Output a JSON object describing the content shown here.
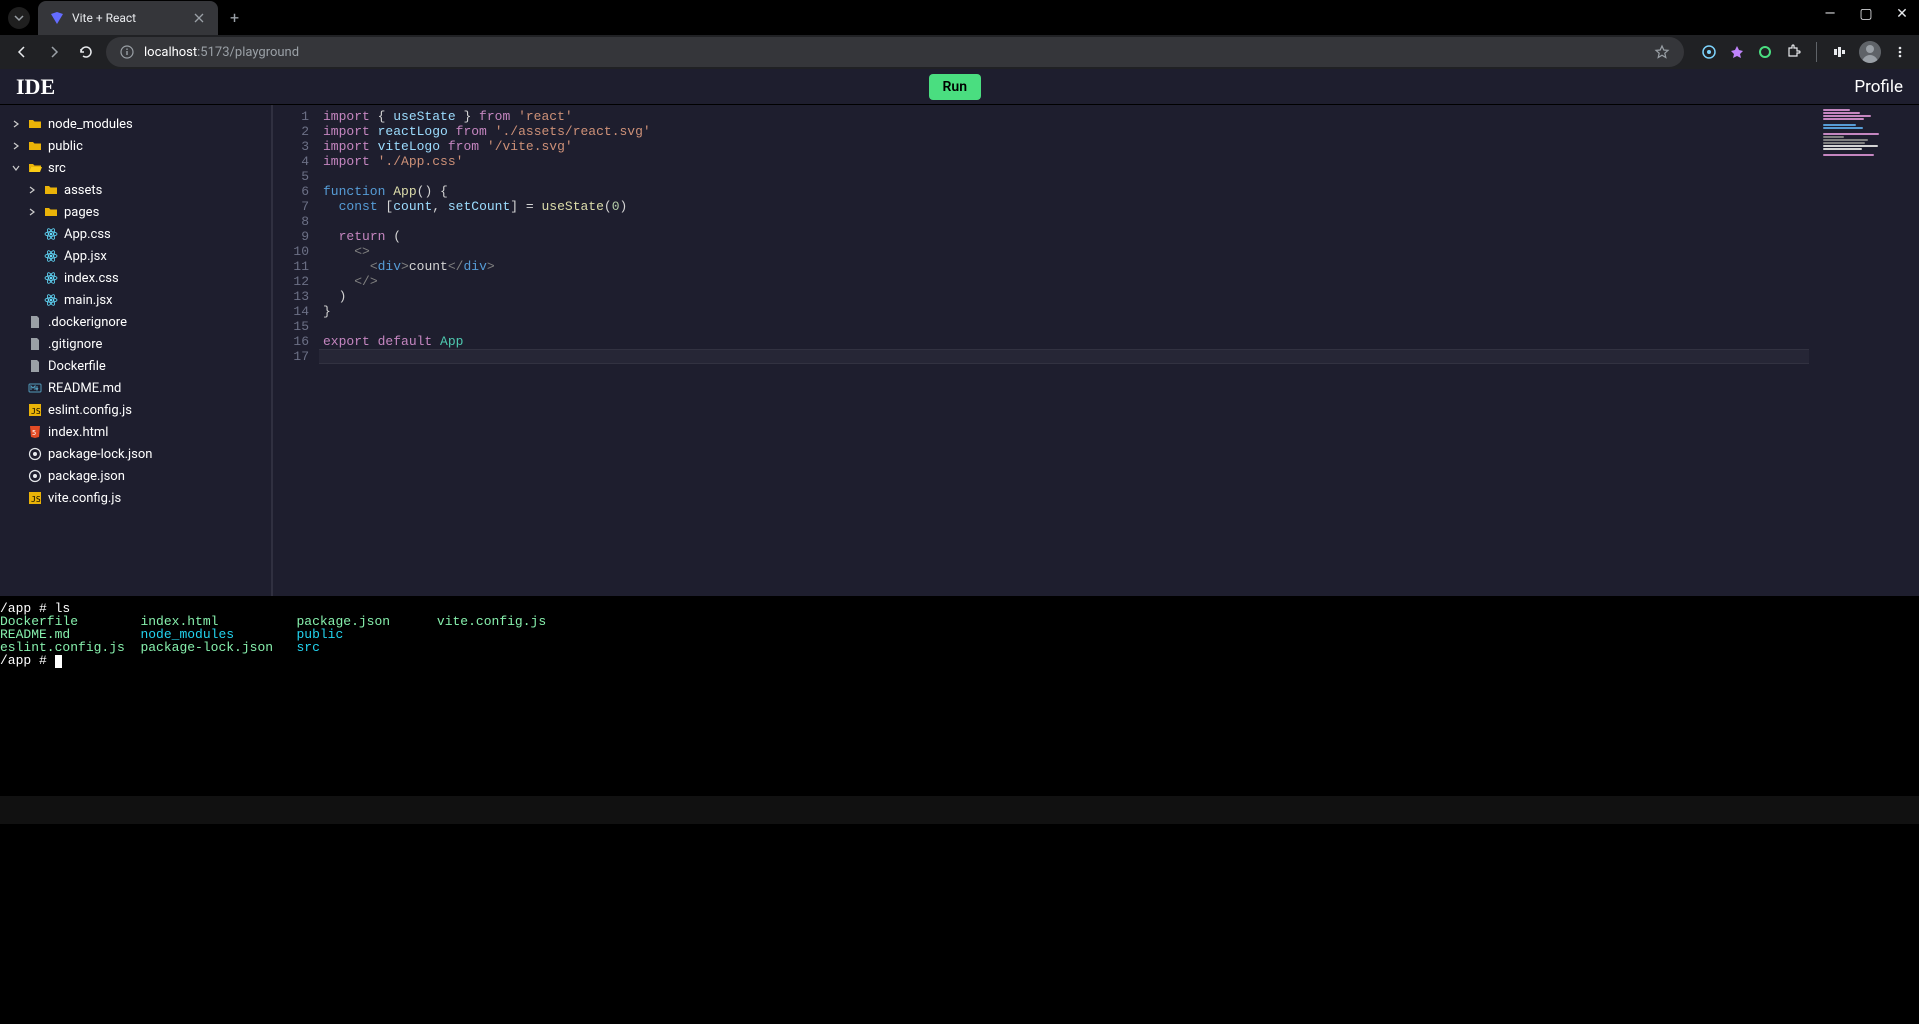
{
  "browser": {
    "tab_title": "Vite + React",
    "url_host": "localhost",
    "url_port": ":5173",
    "url_path": "/playground"
  },
  "app": {
    "logo": "IDE",
    "run_label": "Run",
    "profile_label": "Profile"
  },
  "tree": [
    {
      "depth": 0,
      "chev": "right",
      "icon": "folder",
      "label": "node_modules"
    },
    {
      "depth": 0,
      "chev": "right",
      "icon": "folder",
      "label": "public"
    },
    {
      "depth": 0,
      "chev": "down",
      "icon": "folder-open",
      "label": "src"
    },
    {
      "depth": 1,
      "chev": "right",
      "icon": "folder",
      "label": "assets"
    },
    {
      "depth": 1,
      "chev": "right",
      "icon": "folder",
      "label": "pages"
    },
    {
      "depth": 1,
      "chev": "",
      "icon": "react",
      "label": "App.css"
    },
    {
      "depth": 1,
      "chev": "",
      "icon": "react",
      "label": "App.jsx"
    },
    {
      "depth": 1,
      "chev": "",
      "icon": "react",
      "label": "index.css"
    },
    {
      "depth": 1,
      "chev": "",
      "icon": "react",
      "label": "main.jsx"
    },
    {
      "depth": 0,
      "chev": "",
      "icon": "gray",
      "label": ".dockerignore"
    },
    {
      "depth": 0,
      "chev": "",
      "icon": "gray",
      "label": ".gitignore"
    },
    {
      "depth": 0,
      "chev": "",
      "icon": "gray",
      "label": "Dockerfile"
    },
    {
      "depth": 0,
      "chev": "",
      "icon": "md",
      "label": "README.md"
    },
    {
      "depth": 0,
      "chev": "",
      "icon": "js",
      "label": "eslint.config.js"
    },
    {
      "depth": 0,
      "chev": "",
      "icon": "html",
      "label": "index.html"
    },
    {
      "depth": 0,
      "chev": "",
      "icon": "json",
      "label": "package-lock.json"
    },
    {
      "depth": 0,
      "chev": "",
      "icon": "json",
      "label": "package.json"
    },
    {
      "depth": 0,
      "chev": "",
      "icon": "js",
      "label": "vite.config.js"
    }
  ],
  "editor": {
    "line_count": 17,
    "current_line": 17,
    "lines": [
      [
        [
          "kw",
          "import"
        ],
        [
          "punct",
          " { "
        ],
        [
          "id",
          "useState"
        ],
        [
          "punct",
          " } "
        ],
        [
          "kw",
          "from"
        ],
        [
          "punct",
          " "
        ],
        [
          "str",
          "'react'"
        ]
      ],
      [
        [
          "kw",
          "import"
        ],
        [
          "punct",
          " "
        ],
        [
          "id",
          "reactLogo"
        ],
        [
          "punct",
          " "
        ],
        [
          "kw",
          "from"
        ],
        [
          "punct",
          " "
        ],
        [
          "str",
          "'./assets/react.svg'"
        ]
      ],
      [
        [
          "kw",
          "import"
        ],
        [
          "punct",
          " "
        ],
        [
          "id",
          "viteLogo"
        ],
        [
          "punct",
          " "
        ],
        [
          "kw",
          "from"
        ],
        [
          "punct",
          " "
        ],
        [
          "str",
          "'/vite.svg'"
        ]
      ],
      [
        [
          "kw",
          "import"
        ],
        [
          "punct",
          " "
        ],
        [
          "str",
          "'./App.css'"
        ]
      ],
      [],
      [
        [
          "kw2",
          "function"
        ],
        [
          "punct",
          " "
        ],
        [
          "fn",
          "App"
        ],
        [
          "punct",
          "() {"
        ]
      ],
      [
        [
          "punct",
          "  "
        ],
        [
          "kw2",
          "const"
        ],
        [
          "punct",
          " ["
        ],
        [
          "id",
          "count"
        ],
        [
          "punct",
          ", "
        ],
        [
          "id",
          "setCount"
        ],
        [
          "punct",
          "] = "
        ],
        [
          "fn",
          "useState"
        ],
        [
          "punct",
          "("
        ],
        [
          "num",
          "0"
        ],
        [
          "punct",
          ")"
        ]
      ],
      [],
      [
        [
          "punct",
          "  "
        ],
        [
          "kw",
          "return"
        ],
        [
          "punct",
          " ("
        ]
      ],
      [
        [
          "punct",
          "    "
        ],
        [
          "tag",
          "<>"
        ]
      ],
      [
        [
          "punct",
          "      "
        ],
        [
          "tag",
          "<"
        ],
        [
          "tagname",
          "div"
        ],
        [
          "tag",
          ">"
        ],
        [
          "punct",
          "count"
        ],
        [
          "tag",
          "</"
        ],
        [
          "tagname",
          "div"
        ],
        [
          "tag",
          ">"
        ]
      ],
      [
        [
          "punct",
          "    "
        ],
        [
          "tag",
          "</>"
        ]
      ],
      [
        [
          "punct",
          "  )"
        ]
      ],
      [
        [
          "punct",
          "}"
        ]
      ],
      [],
      [
        [
          "kw",
          "export"
        ],
        [
          "punct",
          " "
        ],
        [
          "kw",
          "default"
        ],
        [
          "punct",
          " "
        ],
        [
          "def",
          "App"
        ]
      ],
      []
    ]
  },
  "terminal": {
    "prompt1": "/app # ",
    "cmd1": "ls",
    "cols": [
      [
        "Dockerfile",
        "README.md",
        "eslint.config.js"
      ],
      [
        "index.html",
        "node_modules",
        "package-lock.json"
      ],
      [
        "package.json",
        "public",
        "src"
      ],
      [
        "vite.config.js",
        "",
        ""
      ]
    ],
    "prompt2": "/app # "
  }
}
